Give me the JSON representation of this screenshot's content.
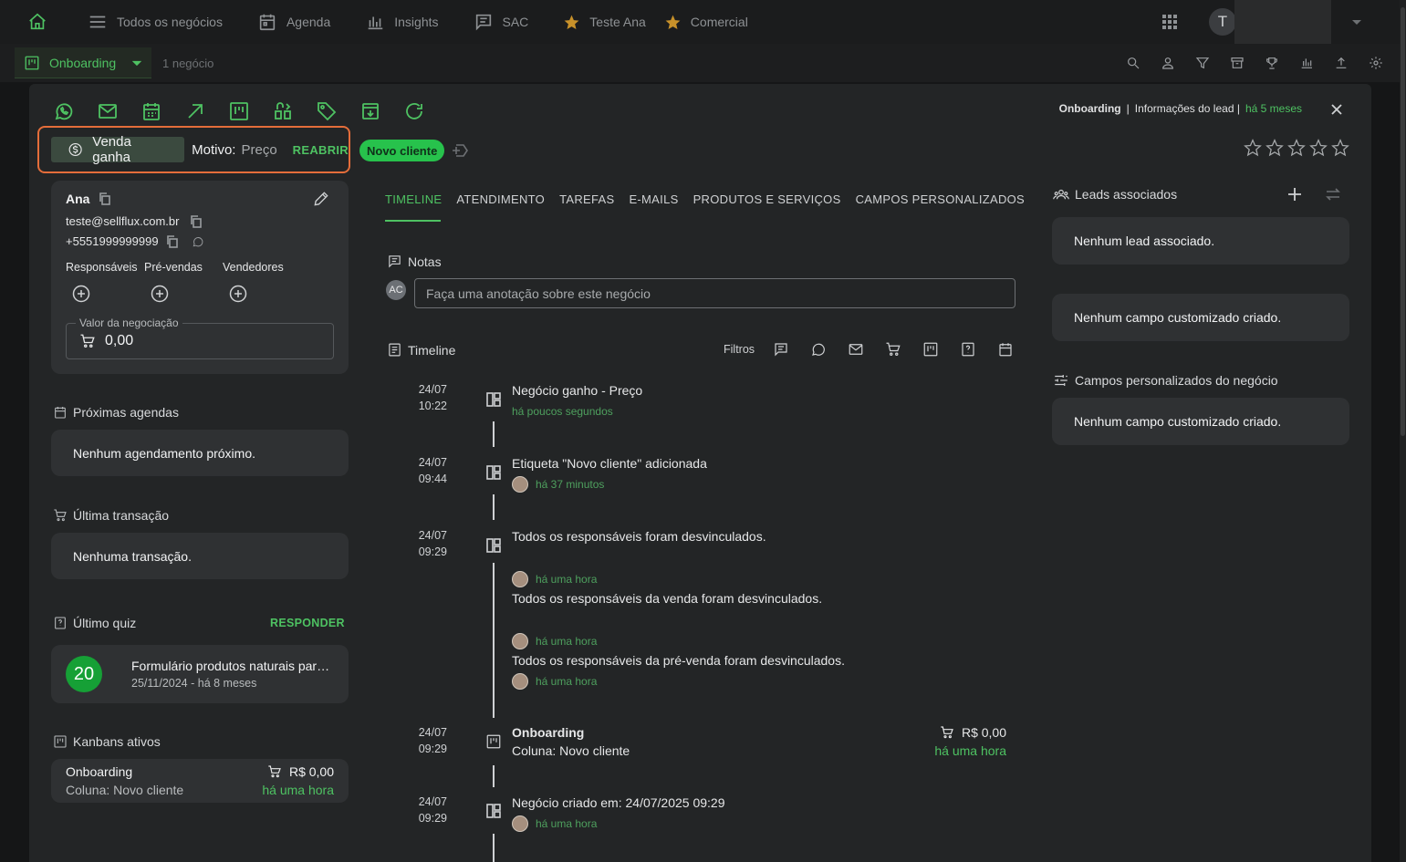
{
  "topnav": {
    "items": [
      {
        "label": "Todos os negócios",
        "icon": "menu-icon"
      },
      {
        "label": "Agenda",
        "icon": "calendar-icon"
      },
      {
        "label": "Insights",
        "icon": "bar-chart-icon"
      },
      {
        "label": "SAC",
        "icon": "chat-icon"
      }
    ],
    "favorites": [
      {
        "label": "Teste Ana",
        "icon": "star-icon"
      },
      {
        "label": "Comercial",
        "icon": "star-icon"
      }
    ],
    "user_initial": "T"
  },
  "subbar": {
    "pipeline": "Onboarding",
    "count": "1 negócio"
  },
  "modal": {
    "breadcrumb": {
      "pipeline": "Onboarding",
      "separator": "|",
      "section": "Informações do lead |",
      "time": "há 5 meses"
    },
    "status": {
      "label": "Venda ganha",
      "motivo_label": "Motivo:",
      "motivo_value": "Preço",
      "reopen": "REABRIR"
    },
    "tag": "Novo cliente",
    "rating": 0,
    "contact": {
      "name": "Ana",
      "email": "teste@sellflux.com.br",
      "phone": "+5551999999999",
      "roles": [
        "Responsáveis",
        "Pré-vendas",
        "Vendedores"
      ],
      "valor_label": "Valor da negociação",
      "valor_value": "0,00"
    },
    "proximas_agendas": {
      "title": "Próximas agendas",
      "empty": "Nenhum agendamento próximo."
    },
    "ultima_transacao": {
      "title": "Última transação",
      "empty": "Nenhuma transação."
    },
    "ultimo_quiz": {
      "title": "Último quiz",
      "action": "RESPONDER",
      "score": "20",
      "name": "Formulário produtos naturais para pets",
      "date": "25/11/2024 - há 8 meses"
    },
    "kanbans": {
      "title": "Kanbans ativos",
      "item": {
        "name": "Onboarding",
        "column": "Coluna: Novo cliente",
        "value": "R$ 0,00",
        "time": "há uma hora"
      }
    },
    "tabs": [
      "TIMELINE",
      "ATENDIMENTO",
      "TAREFAS",
      "E-MAILS",
      "PRODUTOS E SERVIÇOS",
      "CAMPOS PERSONALIZADOS"
    ],
    "notes": {
      "title": "Notas",
      "avatar": "AC",
      "placeholder": "Faça uma anotação sobre este negócio"
    },
    "timeline": {
      "title": "Timeline",
      "filters_label": "Filtros",
      "events": [
        {
          "date": "24/07",
          "time": "10:22",
          "title": "Negócio ganho - Preço",
          "meta": "há poucos segundos"
        },
        {
          "date": "24/07",
          "time": "09:44",
          "title": "Etiqueta \"Novo cliente\" adicionada",
          "meta": "há 37 minutos"
        },
        {
          "date": "24/07",
          "time": "09:29",
          "title": "Todos os responsáveis foram desvinculados.",
          "meta": "há uma hora",
          "extra": [
            {
              "title": "Todos os responsáveis da venda foram desvinculados.",
              "meta": "há uma hora"
            },
            {
              "title": "Todos os responsáveis da pré-venda foram desvinculados.",
              "meta": "há uma hora"
            }
          ]
        },
        {
          "date": "24/07",
          "time": "09:29",
          "title": "Onboarding",
          "subtitle": "Coluna: Novo cliente",
          "value": "R$ 0,00",
          "value_time": "há uma hora"
        },
        {
          "date": "24/07",
          "time": "09:29",
          "title": "Negócio criado em: 24/07/2025 09:29",
          "meta": "há uma hora"
        }
      ]
    },
    "right": {
      "leads_title": "Leads associados",
      "leads_empty": "Nenhum lead associado.",
      "custom_empty": "Nenhum campo customizado criado.",
      "business_fields_title": "Campos personalizados do negócio",
      "business_fields_empty": "Nenhum campo customizado criado."
    }
  },
  "colors": {
    "accent": "#4ec262",
    "highlight": "#e46d3a",
    "bg": "#232526",
    "card": "#2f3133"
  }
}
